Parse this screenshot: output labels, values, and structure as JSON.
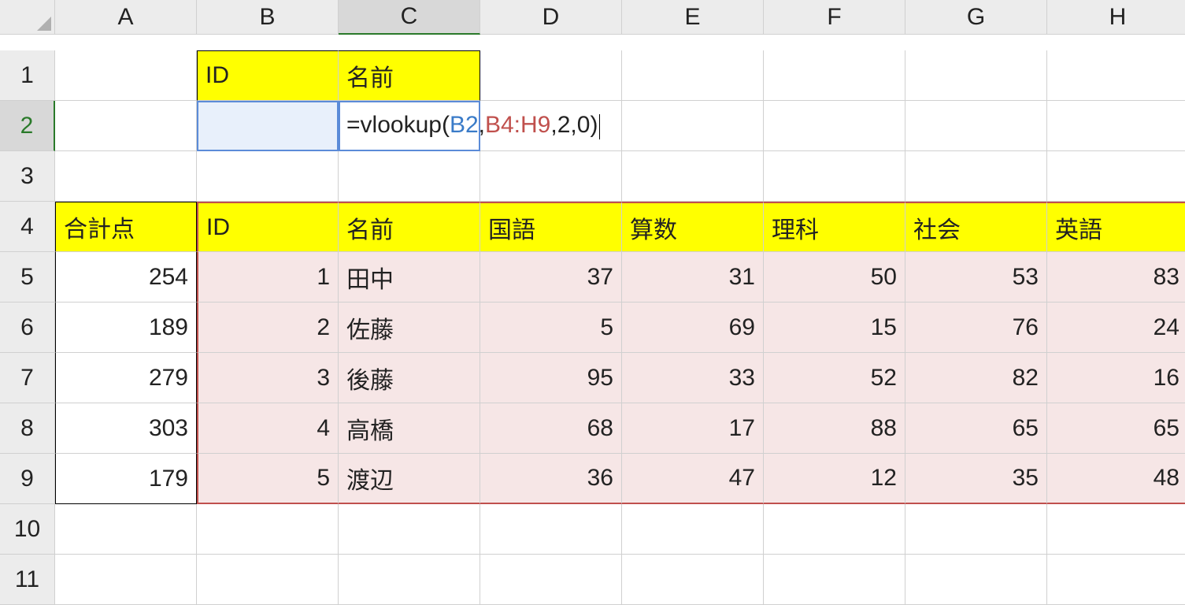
{
  "columns": [
    "A",
    "B",
    "C",
    "D",
    "E",
    "F",
    "G",
    "H"
  ],
  "rows": [
    "1",
    "2",
    "3",
    "4",
    "5",
    "6",
    "7",
    "8",
    "9",
    "10",
    "11"
  ],
  "active_cell": "C2",
  "header_block": {
    "b1": "ID",
    "c1": "名前"
  },
  "formula": {
    "eq": "=",
    "fn": "vlookup",
    "open": "(",
    "ref1": "B2",
    "c1": ",",
    "ref2": "B4:H9",
    "c2": ",",
    "arg3": "2",
    "c3": ",",
    "arg4": "0",
    "close": ")"
  },
  "table_headers": {
    "a4": "合計点",
    "b4": "ID",
    "c4": "名前",
    "d4": "国語",
    "e4": "算数",
    "f4": "理科",
    "g4": "社会",
    "h4": "英語"
  },
  "table_rows": [
    {
      "total": "254",
      "id": "1",
      "name": "田中",
      "d": "37",
      "e": "31",
      "f": "50",
      "g": "53",
      "h": "83"
    },
    {
      "total": "189",
      "id": "2",
      "name": "佐藤",
      "d": "5",
      "e": "69",
      "f": "15",
      "g": "76",
      "h": "24"
    },
    {
      "total": "279",
      "id": "3",
      "name": "後藤",
      "d": "95",
      "e": "33",
      "f": "52",
      "g": "82",
      "h": "16"
    },
    {
      "total": "303",
      "id": "4",
      "name": "高橋",
      "d": "68",
      "e": "17",
      "f": "88",
      "g": "65",
      "h": "65"
    },
    {
      "total": "179",
      "id": "5",
      "name": "渡辺",
      "d": "36",
      "e": "47",
      "f": "12",
      "g": "35",
      "h": "48"
    }
  ]
}
